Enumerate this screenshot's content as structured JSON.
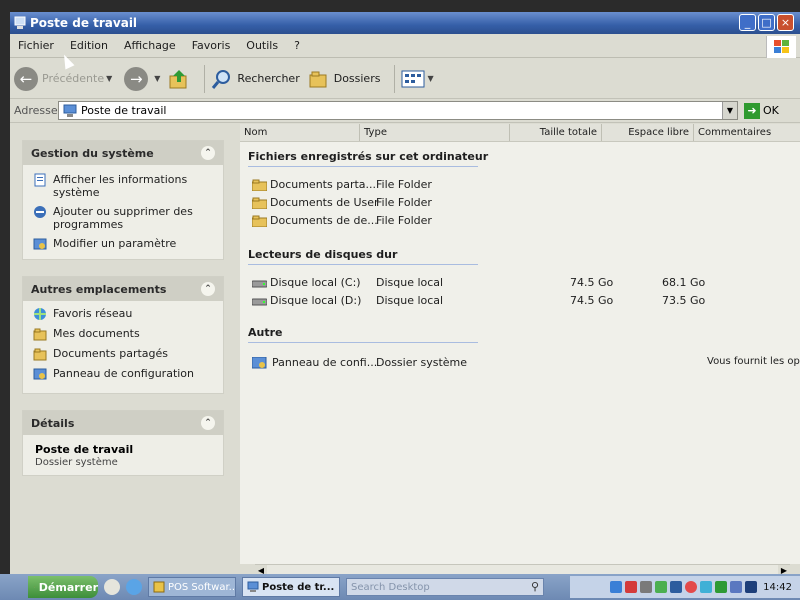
{
  "window": {
    "title": "Poste de travail"
  },
  "menubar": [
    "Fichier",
    "Edition",
    "Affichage",
    "Favoris",
    "Outils",
    "?"
  ],
  "toolbar": {
    "back_label": "Précédente",
    "search_label": "Rechercher",
    "folders_label": "Dossiers"
  },
  "address": {
    "label": "Adresse",
    "value": "Poste de travail",
    "go_label": "OK"
  },
  "sidebar": {
    "system": {
      "header": "Gestion du système",
      "items": [
        "Afficher les informations système",
        "Ajouter ou supprimer des programmes",
        "Modifier un paramètre"
      ]
    },
    "other": {
      "header": "Autres emplacements",
      "items": [
        "Favoris réseau",
        "Mes documents",
        "Documents partagés",
        "Panneau de configuration"
      ]
    },
    "details": {
      "header": "Détails",
      "title": "Poste de travail",
      "subtitle": "Dossier système"
    }
  },
  "columns": [
    "Nom",
    "Type",
    "Taille totale",
    "Espace libre",
    "Commentaires"
  ],
  "groups": [
    {
      "title": "Fichiers enregistrés sur cet ordinateur",
      "rows": [
        {
          "name": "Documents parta...",
          "type": "File Folder"
        },
        {
          "name": "Documents de User",
          "type": "File Folder"
        },
        {
          "name": "Documents de de...",
          "type": "File Folder"
        }
      ]
    },
    {
      "title": "Lecteurs de disques dur",
      "rows": [
        {
          "name": "Disque local (C:)",
          "type": "Disque local",
          "total": "74.5 Go",
          "free": "68.1 Go"
        },
        {
          "name": "Disque local (D:)",
          "type": "Disque local",
          "total": "74.5 Go",
          "free": "73.5 Go"
        }
      ]
    },
    {
      "title": "Autre",
      "rows": [
        {
          "name": "Panneau de confi...",
          "type": "Dossier système",
          "comment": "Vous fournit les opti..."
        }
      ]
    }
  ],
  "taskbar": {
    "start_label": "Démarrer",
    "tasks": [
      "POS Softwar...",
      "Poste de tr..."
    ],
    "search_placeholder": "Search Desktop",
    "clock": "14:42"
  }
}
